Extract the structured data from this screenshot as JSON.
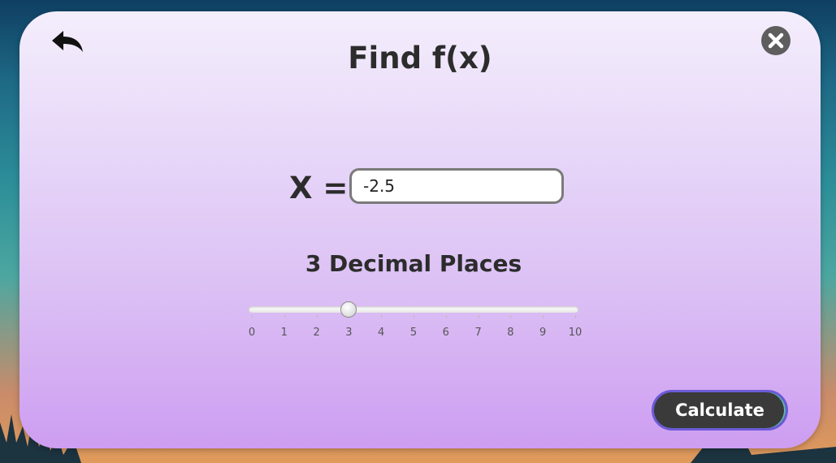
{
  "dialog": {
    "title": "Find f(x)",
    "x_label": "X =",
    "x_input_value": "-2.5",
    "decimal_label": "3 Decimal Places",
    "slider": {
      "min": 0,
      "max": 10,
      "value": 3,
      "ticks": [
        "0",
        "1",
        "2",
        "3",
        "4",
        "5",
        "6",
        "7",
        "8",
        "9",
        "10"
      ]
    },
    "calculate_label": "Calculate"
  },
  "icons": {
    "back": "back-arrow-icon",
    "close": "close-circle-icon"
  },
  "colors": {
    "panel_top": "#f4eefc",
    "panel_bottom": "#cd9df1",
    "button_bg": "#3a3a3a",
    "button_border": "#6a5bd6",
    "text": "#2c2c2c"
  }
}
